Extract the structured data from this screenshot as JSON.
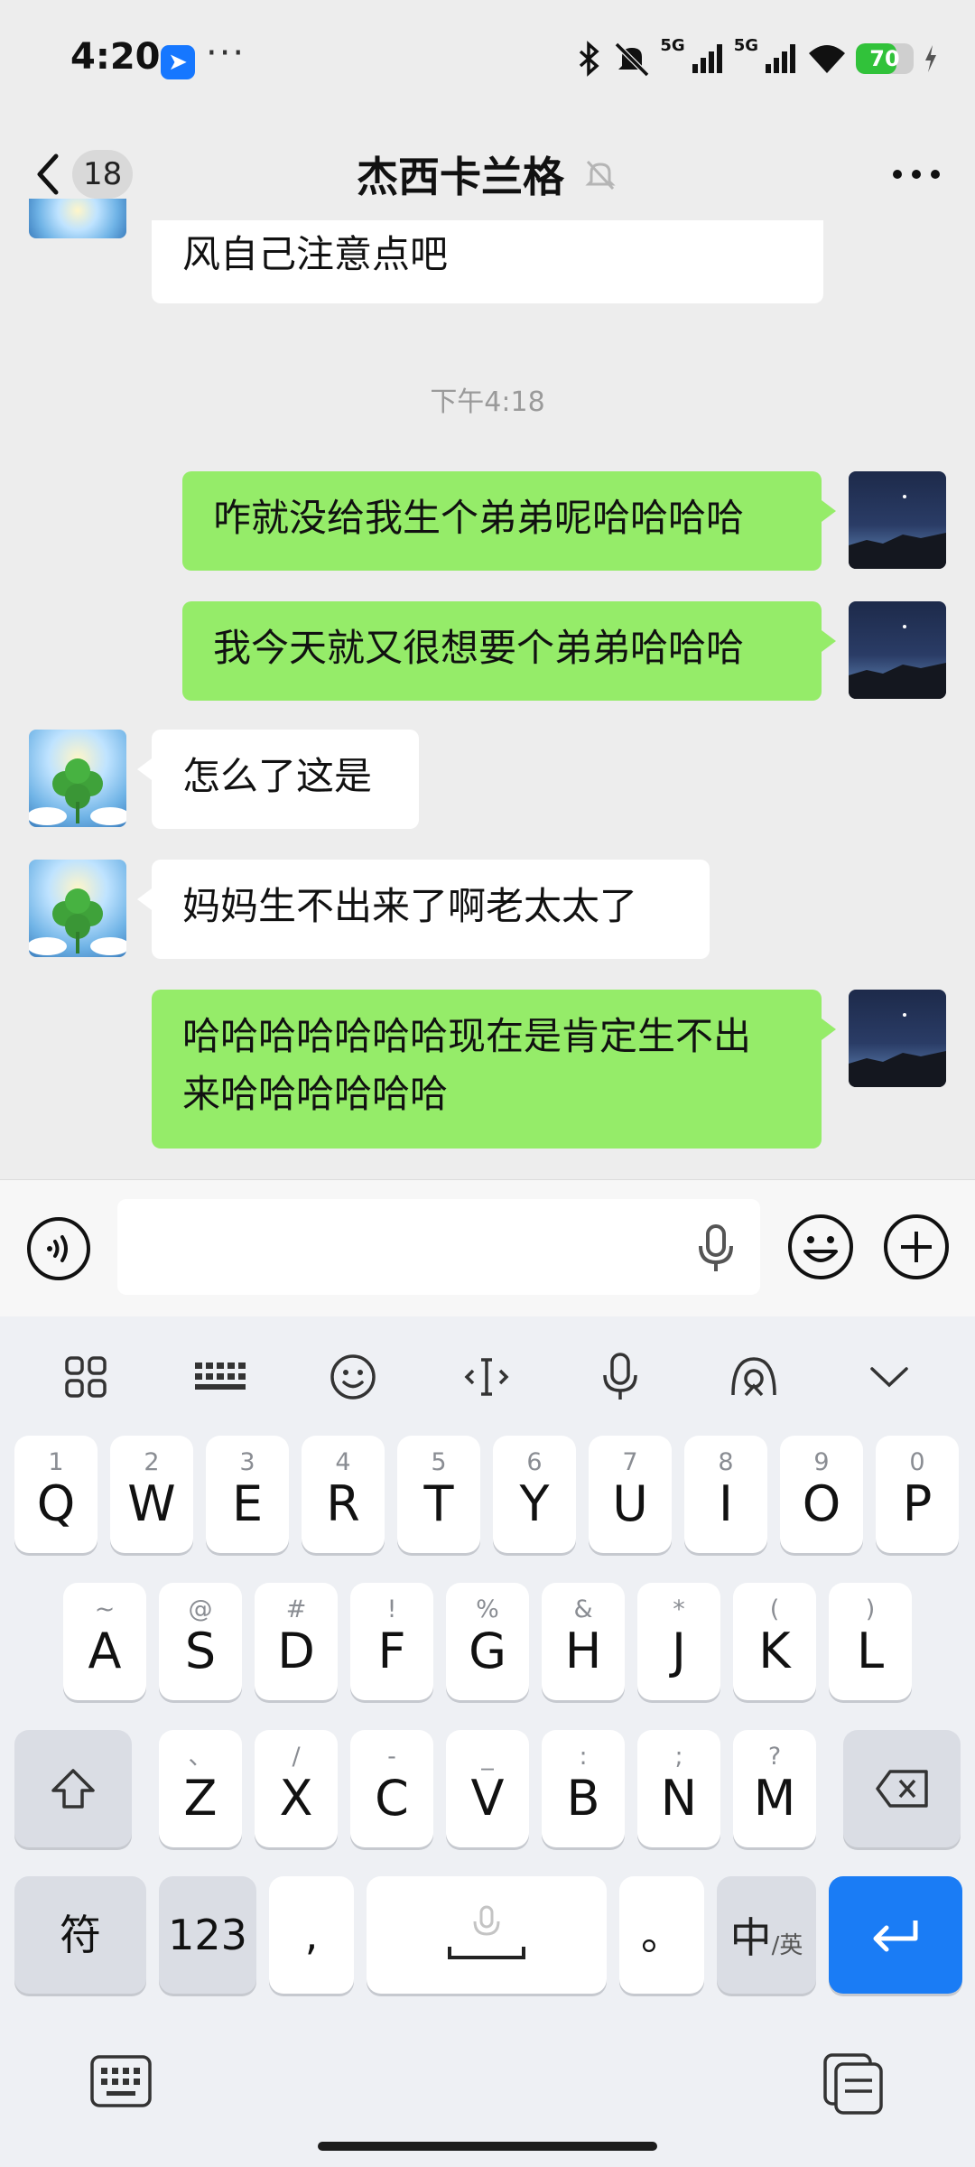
{
  "status_bar": {
    "time": "4:20",
    "dots": "···",
    "network_1": "5G",
    "network_2": "5G",
    "battery": "70",
    "battery_level": 0.7,
    "colors": {
      "battery_fill": "#31c23a",
      "app_badge": "#1677ff"
    }
  },
  "nav": {
    "unread_count": "18",
    "title": "杰西卡兰格"
  },
  "chat": {
    "timestamp": "下午4:18",
    "messages": [
      {
        "side": "left",
        "text": "风自己注意点吧"
      },
      {
        "side": "right",
        "text": "咋就没给我生个弟弟呢哈哈哈哈"
      },
      {
        "side": "right",
        "text": "我今天就又很想要个弟弟哈哈哈"
      },
      {
        "side": "left",
        "text": "怎么了这是"
      },
      {
        "side": "left",
        "text": "妈妈生不出来了啊老太太了"
      },
      {
        "side": "right",
        "text_line1": "哈哈哈哈哈哈哈现在是肯定生不出",
        "text_line2": "来哈哈哈哈哈哈"
      }
    ],
    "colors": {
      "my_bubble": "#95ec69",
      "their_bubble": "#ffffff"
    }
  },
  "input_bar": {
    "input_value": "",
    "icons": [
      "voice-icon",
      "mic-icon",
      "emoji-icon",
      "plus-icon"
    ]
  },
  "keyboard": {
    "toolbar_icons": [
      "apps-icon",
      "keyboard-layout-icon",
      "emoji-icon",
      "cursor-icon",
      "mic-icon",
      "skin-icon",
      "collapse-icon"
    ],
    "row1": [
      {
        "k": "Q",
        "s": "1"
      },
      {
        "k": "W",
        "s": "2"
      },
      {
        "k": "E",
        "s": "3"
      },
      {
        "k": "R",
        "s": "4"
      },
      {
        "k": "T",
        "s": "5"
      },
      {
        "k": "Y",
        "s": "6"
      },
      {
        "k": "U",
        "s": "7"
      },
      {
        "k": "I",
        "s": "8"
      },
      {
        "k": "O",
        "s": "9"
      },
      {
        "k": "P",
        "s": "0"
      }
    ],
    "row2": [
      {
        "k": "A",
        "s": "~"
      },
      {
        "k": "S",
        "s": "@"
      },
      {
        "k": "D",
        "s": "#"
      },
      {
        "k": "F",
        "s": "!"
      },
      {
        "k": "G",
        "s": "%"
      },
      {
        "k": "H",
        "s": "&"
      },
      {
        "k": "J",
        "s": "*"
      },
      {
        "k": "K",
        "s": "("
      },
      {
        "k": "L",
        "s": ")"
      }
    ],
    "row3": [
      {
        "k": "Z",
        "s": "、"
      },
      {
        "k": "X",
        "s": "/"
      },
      {
        "k": "C",
        "s": "-"
      },
      {
        "k": "V",
        "s": "_"
      },
      {
        "k": "B",
        "s": ":"
      },
      {
        "k": "N",
        "s": ";"
      },
      {
        "k": "M",
        "s": "?"
      }
    ],
    "symbols_label": "符",
    "numbers_label": "123",
    "comma_label": ",",
    "period_label": "。",
    "lang_main": "中",
    "lang_sub": "/英",
    "colors": {
      "enter_key": "#1a7cf5"
    }
  }
}
